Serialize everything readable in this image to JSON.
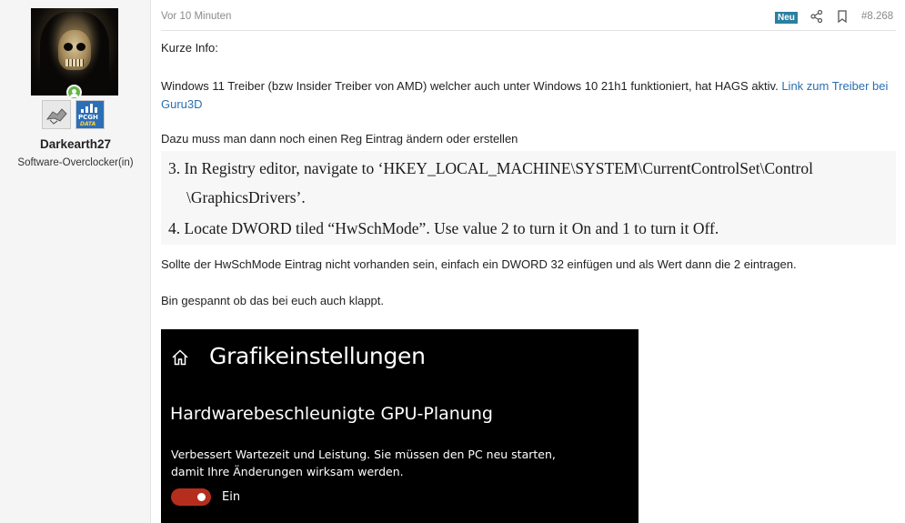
{
  "sidebar": {
    "username": "Darkearth27",
    "user_title": "Software-Overclocker(in)",
    "pcgh_badge_line1": "PCGH",
    "pcgh_badge_line2": "DATA"
  },
  "post": {
    "time": "Vor 10 Minuten",
    "new_badge": "Neu",
    "number": "#8.268",
    "p1": "Kurze Info:",
    "p2_text": "Windows 11 Treiber (bzw Insider Treiber von AMD) welcher auch unter Windows 10 21h1 funktioniert, hat HAGS aktiv. ",
    "p2_link": "Link zum Treiber bei Guru3D",
    "p3": "Dazu muss man dann noch einen Reg Eintrag ändern oder erstellen",
    "reg_line1": "3. In Registry editor, navigate to ‘HKEY_LOCAL_MACHINE\\SYSTEM\\CurrentControlSet\\Control",
    "reg_line2": "\\GraphicsDrivers’.",
    "reg_line3": "4. Locate DWORD tiled “HwSchMode”. Use value 2 to turn it On and 1 to turn it Off.",
    "p4": "Sollte der HwSchMode Eintrag nicht vorhanden sein, einfach ein DWORD 32 einfügen und als Wert dann die 2 eintragen.",
    "p5": "Bin gespannt ob das bei euch auch klappt."
  },
  "screenshot": {
    "title": "Grafikeinstellungen",
    "subtitle": "Hardwarebeschleunigte GPU-Planung",
    "description": "Verbessert Wartezeit und Leistung. Sie müssen den PC neu starten, damit Ihre Änderungen wirksam werden.",
    "toggle_label": "Ein",
    "toggle_state": "on",
    "toggle_color": "#b52e1d"
  },
  "colors": {
    "link": "#2a6fb0",
    "new_badge": "#2a7fa0",
    "online": "#63b34b"
  }
}
